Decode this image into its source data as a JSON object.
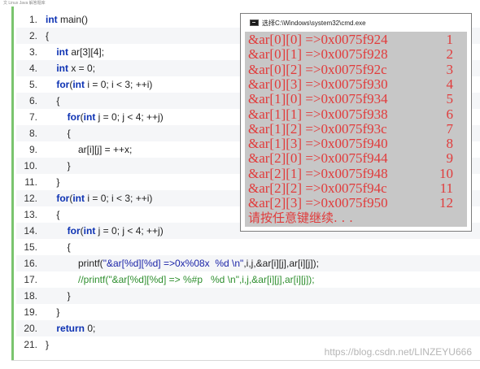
{
  "top_strip_text": "文  Linux   Java   解答题库",
  "code": {
    "lines": [
      {
        "num": "1.",
        "segments": [
          {
            "t": "kw",
            "v": "int"
          },
          {
            "t": "plain",
            "v": " main()"
          }
        ]
      },
      {
        "num": "2.",
        "segments": [
          {
            "t": "plain",
            "v": "{"
          }
        ]
      },
      {
        "num": "3.",
        "segments": [
          {
            "t": "plain",
            "v": "    "
          },
          {
            "t": "kw",
            "v": "int"
          },
          {
            "t": "plain",
            "v": " ar[3][4];"
          }
        ]
      },
      {
        "num": "4.",
        "segments": [
          {
            "t": "plain",
            "v": "    "
          },
          {
            "t": "kw",
            "v": "int"
          },
          {
            "t": "plain",
            "v": " x = 0;"
          }
        ]
      },
      {
        "num": "5.",
        "segments": [
          {
            "t": "plain",
            "v": "    "
          },
          {
            "t": "kw",
            "v": "for"
          },
          {
            "t": "plain",
            "v": "("
          },
          {
            "t": "kw",
            "v": "int"
          },
          {
            "t": "plain",
            "v": " i = 0; i < 3; ++i)"
          }
        ]
      },
      {
        "num": "6.",
        "segments": [
          {
            "t": "plain",
            "v": "    {"
          }
        ]
      },
      {
        "num": "7.",
        "segments": [
          {
            "t": "plain",
            "v": "        "
          },
          {
            "t": "kw",
            "v": "for"
          },
          {
            "t": "plain",
            "v": "("
          },
          {
            "t": "kw",
            "v": "int"
          },
          {
            "t": "plain",
            "v": " j = 0; j < 4; ++j)"
          }
        ]
      },
      {
        "num": "8.",
        "segments": [
          {
            "t": "plain",
            "v": "        {"
          }
        ]
      },
      {
        "num": "9.",
        "segments": [
          {
            "t": "plain",
            "v": "            ar[i][j] = ++x;"
          }
        ]
      },
      {
        "num": "10.",
        "segments": [
          {
            "t": "plain",
            "v": "        }"
          }
        ]
      },
      {
        "num": "11.",
        "segments": [
          {
            "t": "plain",
            "v": "    }"
          }
        ]
      },
      {
        "num": "12.",
        "segments": [
          {
            "t": "plain",
            "v": "    "
          },
          {
            "t": "kw",
            "v": "for"
          },
          {
            "t": "plain",
            "v": "("
          },
          {
            "t": "kw",
            "v": "int"
          },
          {
            "t": "plain",
            "v": " i = 0; i < 3; ++i)"
          }
        ]
      },
      {
        "num": "13.",
        "segments": [
          {
            "t": "plain",
            "v": "    {"
          }
        ]
      },
      {
        "num": "14.",
        "segments": [
          {
            "t": "plain",
            "v": "        "
          },
          {
            "t": "kw",
            "v": "for"
          },
          {
            "t": "plain",
            "v": "("
          },
          {
            "t": "kw",
            "v": "int"
          },
          {
            "t": "plain",
            "v": " j = 0; j < 4; ++j)"
          }
        ]
      },
      {
        "num": "15.",
        "segments": [
          {
            "t": "plain",
            "v": "        {"
          }
        ]
      },
      {
        "num": "16.",
        "segments": [
          {
            "t": "plain",
            "v": "            printf("
          },
          {
            "t": "str",
            "v": "\"&ar[%d][%d] =>0x%08x  %d \\n\""
          },
          {
            "t": "plain",
            "v": ",i,j,&ar[i][j],ar[i][j]);"
          }
        ]
      },
      {
        "num": "17.",
        "segments": [
          {
            "t": "cmt",
            "v": "            //printf(\"&ar[%d][%d] => %#p   %d \\n\",i,j,&ar[i][j],ar[i][j]);"
          }
        ]
      },
      {
        "num": "18.",
        "segments": [
          {
            "t": "plain",
            "v": "        }"
          }
        ]
      },
      {
        "num": "19.",
        "segments": [
          {
            "t": "plain",
            "v": "    }"
          }
        ]
      },
      {
        "num": "20.",
        "segments": [
          {
            "t": "plain",
            "v": "    "
          },
          {
            "t": "kw",
            "v": "return"
          },
          {
            "t": "plain",
            "v": " 0;"
          }
        ]
      },
      {
        "num": "21.",
        "segments": [
          {
            "t": "plain",
            "v": "}"
          }
        ]
      }
    ]
  },
  "cmd": {
    "title": "选择C:\\Windows\\system32\\cmd.exe",
    "output": [
      {
        "text": "&ar[0][0] =>0x0075f924",
        "idx": "1"
      },
      {
        "text": "&ar[0][1] =>0x0075f928",
        "idx": "2"
      },
      {
        "text": "&ar[0][2] =>0x0075f92c",
        "idx": "3"
      },
      {
        "text": "&ar[0][3] =>0x0075f930",
        "idx": "4"
      },
      {
        "text": "&ar[1][0] =>0x0075f934",
        "idx": "5"
      },
      {
        "text": "&ar[1][1] =>0x0075f938",
        "idx": "6"
      },
      {
        "text": "&ar[1][2] =>0x0075f93c",
        "idx": "7"
      },
      {
        "text": "&ar[1][3] =>0x0075f940",
        "idx": "8"
      },
      {
        "text": "&ar[2][0] =>0x0075f944",
        "idx": "9"
      },
      {
        "text": "&ar[2][1] =>0x0075f948",
        "idx": "10"
      },
      {
        "text": "&ar[2][2] =>0x0075f94c",
        "idx": "11"
      },
      {
        "text": "&ar[2][3] =>0x0075f950",
        "idx": "12"
      }
    ],
    "prompt": "请按任意键继续. . ."
  },
  "watermark": "https://blog.csdn.net/LINZEYU666"
}
